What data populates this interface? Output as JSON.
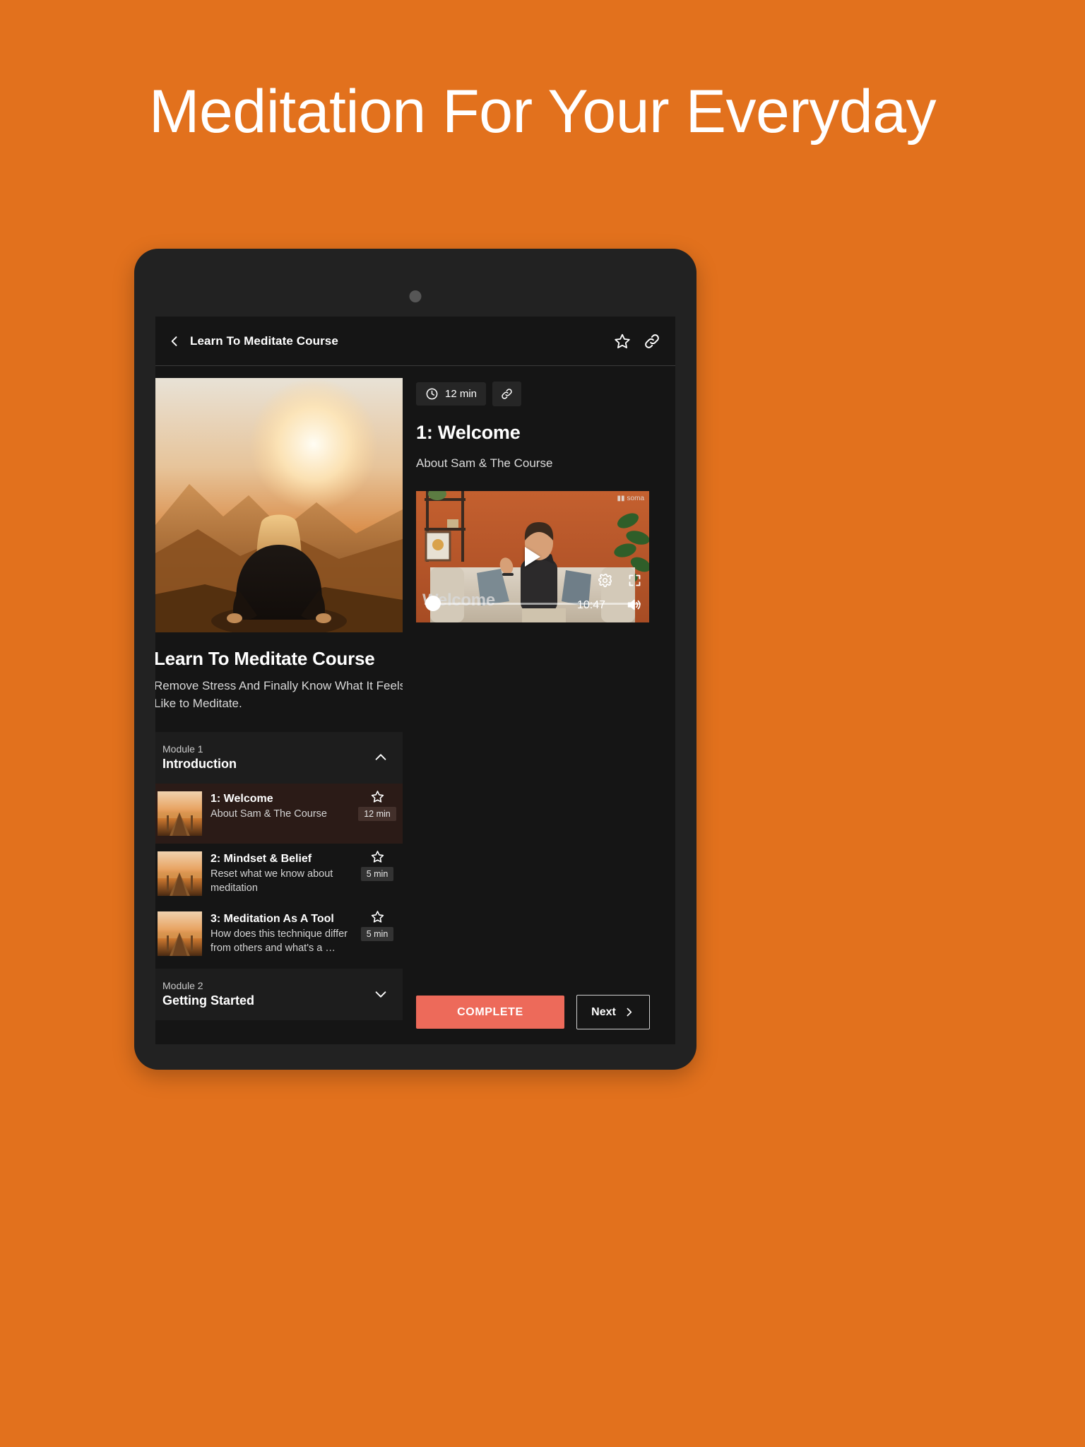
{
  "promo": {
    "headline": "Meditation For Your Everyday"
  },
  "colors": {
    "background_orange": "#E2711D",
    "complete_button": "#ED6A5A",
    "screen_dark": "#151515",
    "active_row": "#2B1B17"
  },
  "app_header": {
    "back_icon": "chevron-left-icon",
    "title": "Learn To Meditate Course",
    "actions": [
      {
        "icon": "star-outline-icon",
        "name": "favorite-button"
      },
      {
        "icon": "link-icon",
        "name": "share-link-button"
      }
    ]
  },
  "course": {
    "title": "Learn To Meditate Course",
    "description": "Remove Stress And Finally Know What It Feels Like to Meditate.",
    "hero_image": "meditation-sunset-photo"
  },
  "modules": [
    {
      "kicker": "Module 1",
      "name": "Introduction",
      "expanded": true,
      "chevron": "chevron-up-icon",
      "lessons": [
        {
          "title": "1: Welcome",
          "description": "About Sam & The Course",
          "duration": "12 min",
          "star": "star-outline-icon",
          "active": true
        },
        {
          "title": "2: Mindset & Belief",
          "description": "Reset what we know about meditation",
          "duration": "5 min",
          "star": "star-outline-icon",
          "active": false
        },
        {
          "title": "3: Meditation As A Tool",
          "description": "How does this technique differ from others and what's a …",
          "duration": "5 min",
          "star": "star-outline-icon",
          "active": false
        }
      ]
    },
    {
      "kicker": "Module 2",
      "name": "Getting Started",
      "expanded": false,
      "chevron": "chevron-down-icon",
      "lessons": []
    }
  ],
  "detail": {
    "duration_chip": "12 min",
    "duration_icon": "clock-icon",
    "link_icon": "link-icon",
    "title": "1: Welcome",
    "subtitle": "About Sam & The Course",
    "player": {
      "overlay_title": "Welcome",
      "time_remaining": "10:47",
      "brand": "soma",
      "play_icon": "play-icon",
      "settings_icon": "gear-icon",
      "fullscreen_icon": "fullscreen-icon",
      "volume_icon": "volume-icon"
    },
    "buttons": {
      "complete": "COMPLETE",
      "next": "Next",
      "next_icon": "chevron-right-icon"
    }
  }
}
